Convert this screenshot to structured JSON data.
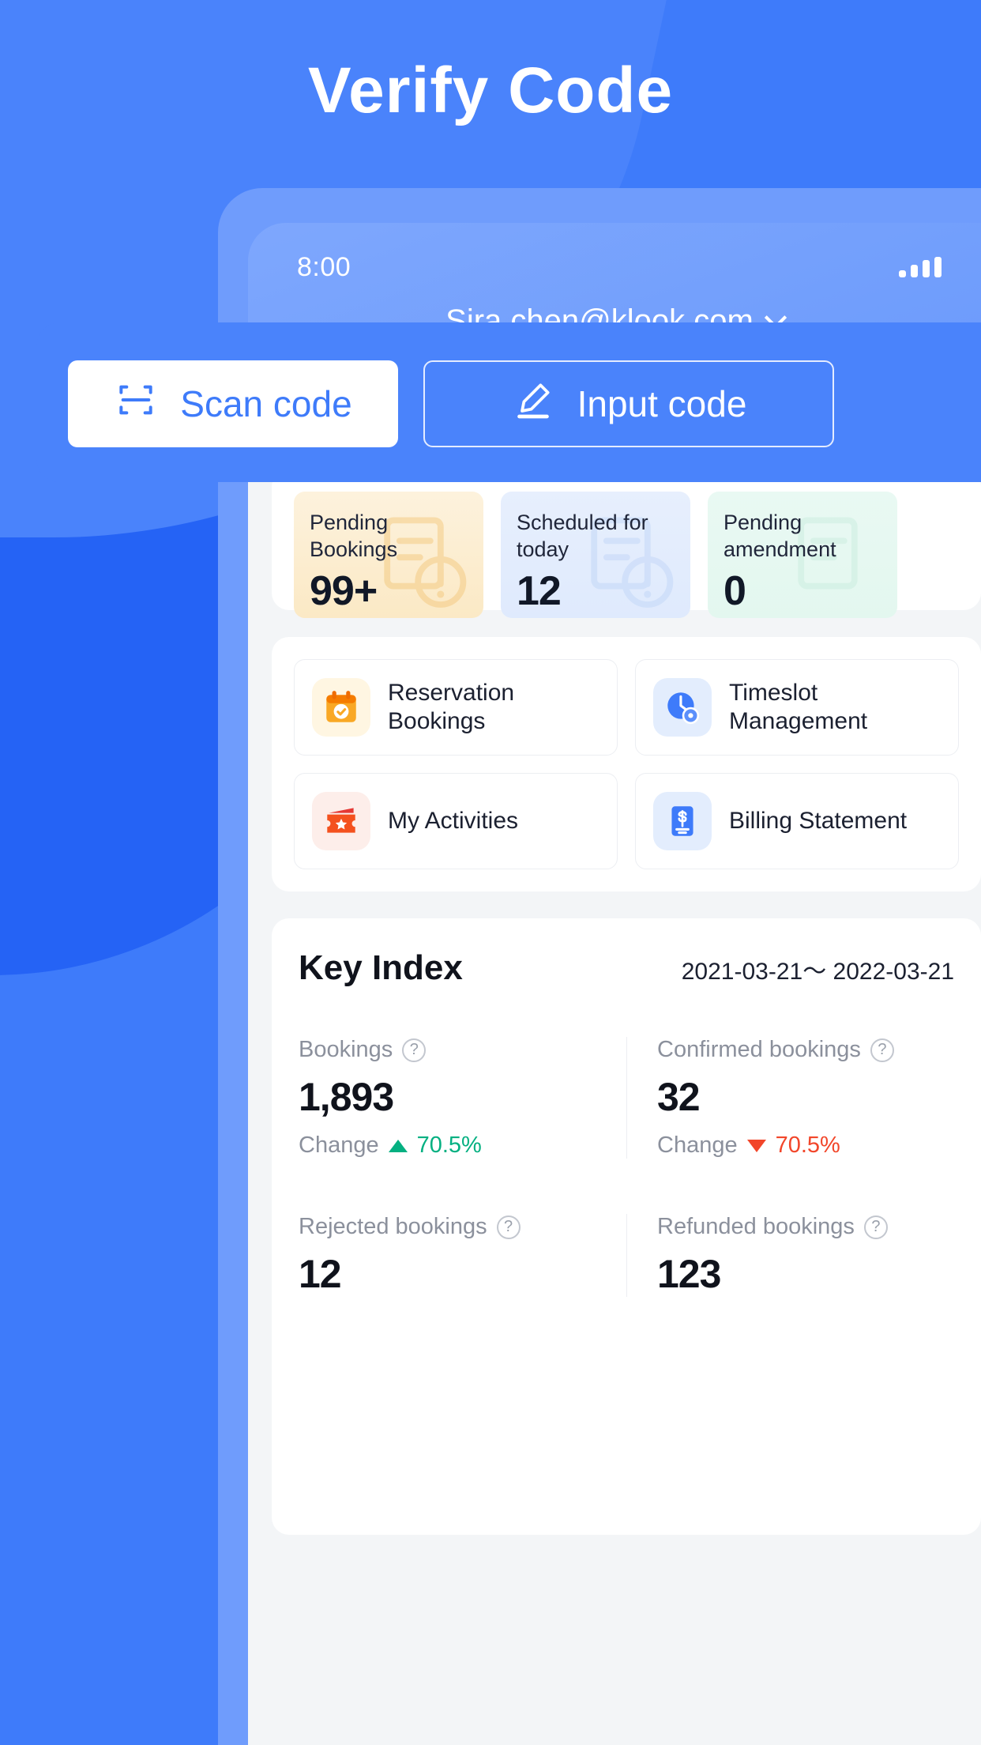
{
  "page": {
    "title": "Verify Code",
    "accent": "#3e7bfa"
  },
  "phone": {
    "status_bar": {
      "time": "8:00",
      "signal_icon": "signal-bars-icon"
    },
    "account": {
      "email": "Sira.chen@klook.com",
      "chevron_icon": "chevron-down-icon"
    }
  },
  "stats": [
    {
      "label": "Pending Bookings",
      "value": "99+",
      "tone": "amber",
      "ghost_icon": "form-clock-icon"
    },
    {
      "label": "Scheduled for today",
      "value": "12",
      "tone": "blue",
      "ghost_icon": "form-alert-icon"
    },
    {
      "label": "Pending amendment",
      "value": "0",
      "tone": "mint",
      "ghost_icon": "form-icon"
    }
  ],
  "menu": [
    {
      "label": "Reservation Bookings",
      "icon": "calendar-check-icon",
      "tone": "amber"
    },
    {
      "label": "Timeslot Management",
      "icon": "clock-gear-icon",
      "tone": "blue"
    },
    {
      "label": "My Activities",
      "icon": "ticket-star-icon",
      "tone": "red"
    },
    {
      "label": "Billing Statement",
      "icon": "billing-dollar-icon",
      "tone": "blue"
    }
  ],
  "key_index": {
    "title": "Key Index",
    "date_range": "2021-03-21〜 2022-03-21",
    "change_label": "Change",
    "help_icon": "question-mark-icon",
    "metrics": [
      {
        "label": "Bookings",
        "value": "1,893",
        "change": "70.5%",
        "direction": "up",
        "color": "#04b081"
      },
      {
        "label": "Confirmed bookings",
        "value": "32",
        "change": "70.5%",
        "direction": "down",
        "color": "#f2462a"
      },
      {
        "label": "Rejected bookings",
        "value": "12",
        "change": "",
        "direction": "",
        "color": ""
      },
      {
        "label": "Refunded bookings",
        "value": "123",
        "change": "",
        "direction": "",
        "color": ""
      }
    ]
  },
  "overlay": {
    "scan_button": {
      "label": "Scan code",
      "icon": "scan-frame-icon"
    },
    "input_button": {
      "label": "Input  code",
      "icon": "pencil-edit-icon"
    }
  }
}
